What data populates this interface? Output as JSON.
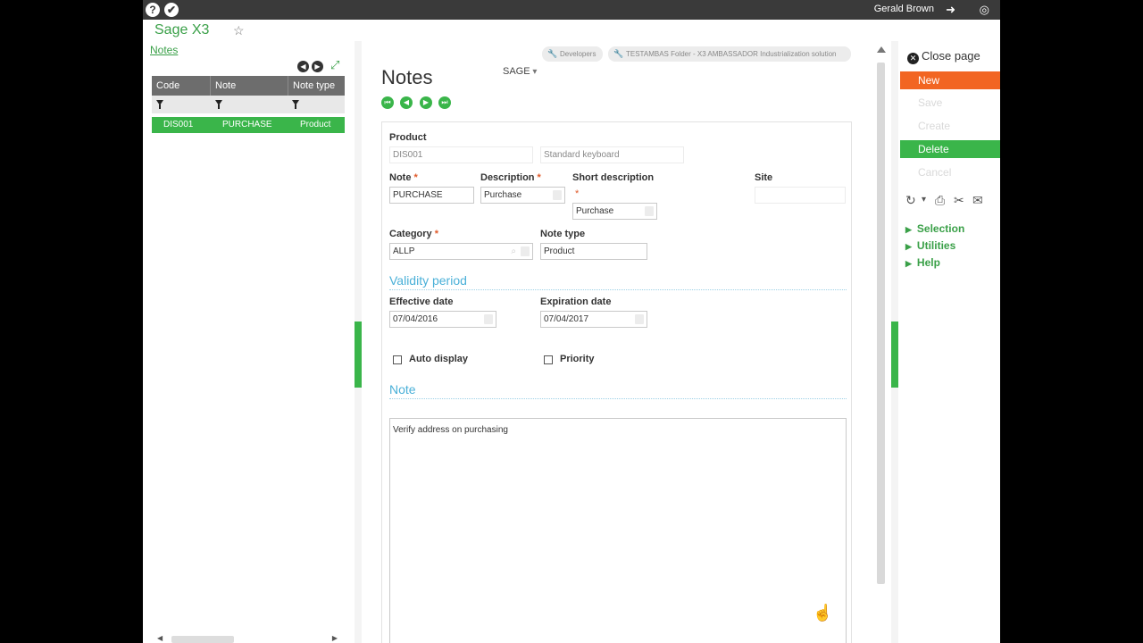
{
  "topbar": {
    "user_name": "Gerald Brown",
    "help_icon": "?",
    "tools_icon": "✔",
    "logout_icon": "➜",
    "globe_icon": "◎"
  },
  "app": {
    "title": "Sage X3"
  },
  "left": {
    "title": "Notes",
    "columns": [
      "Code",
      "Note",
      "Note type"
    ],
    "rows": [
      {
        "code": "DIS001",
        "note": "PURCHASE",
        "type": "Product"
      }
    ],
    "prev": "◀",
    "next": "▶",
    "expand": "⤢"
  },
  "header": {
    "developers": "Developers",
    "folder": "TESTAMBAS Folder - X3 AMBASSADOR Industrialization solution",
    "page_title": "Notes",
    "sage_menu": "SAGE"
  },
  "record_nav": [
    "⏮",
    "◀",
    "▶",
    "⏭"
  ],
  "form": {
    "product_label": "Product",
    "product_code": "DIS001",
    "product_desc": "Standard keyboard",
    "note_label": "Note",
    "note_value": "PURCHASE",
    "description_label": "Description",
    "description_value": "Purchase",
    "short_desc_label": "Short description",
    "short_desc_value": "Purchase",
    "site_label": "Site",
    "site_value": "",
    "required_mark": "*",
    "category_label": "Category",
    "category_value": "ALLP",
    "note_type_label": "Note type",
    "note_type_value": "Product",
    "validity_section": "Validity period",
    "effective_label": "Effective date",
    "effective_value": "07/04/2016",
    "expiration_label": "Expiration date",
    "expiration_value": "07/04/2017",
    "auto_display_label": "Auto display",
    "priority_label": "Priority",
    "note_section": "Note",
    "note_text": "Verify address on purchasing"
  },
  "actions": {
    "close_page": "Close page",
    "close_x": "✕",
    "new": "New",
    "save": "Save",
    "create": "Create",
    "delete": "Delete",
    "cancel": "Cancel",
    "new_color": "#f26522",
    "delete_color": "#3ab54a"
  },
  "tools": {
    "refresh": "↻",
    "dropdown": "▾",
    "print": "⎙",
    "attach": "✂",
    "comment": "✉"
  },
  "menu": {
    "selection": "Selection",
    "utilities": "Utilities",
    "help": "Help"
  },
  "cursor": "☝"
}
